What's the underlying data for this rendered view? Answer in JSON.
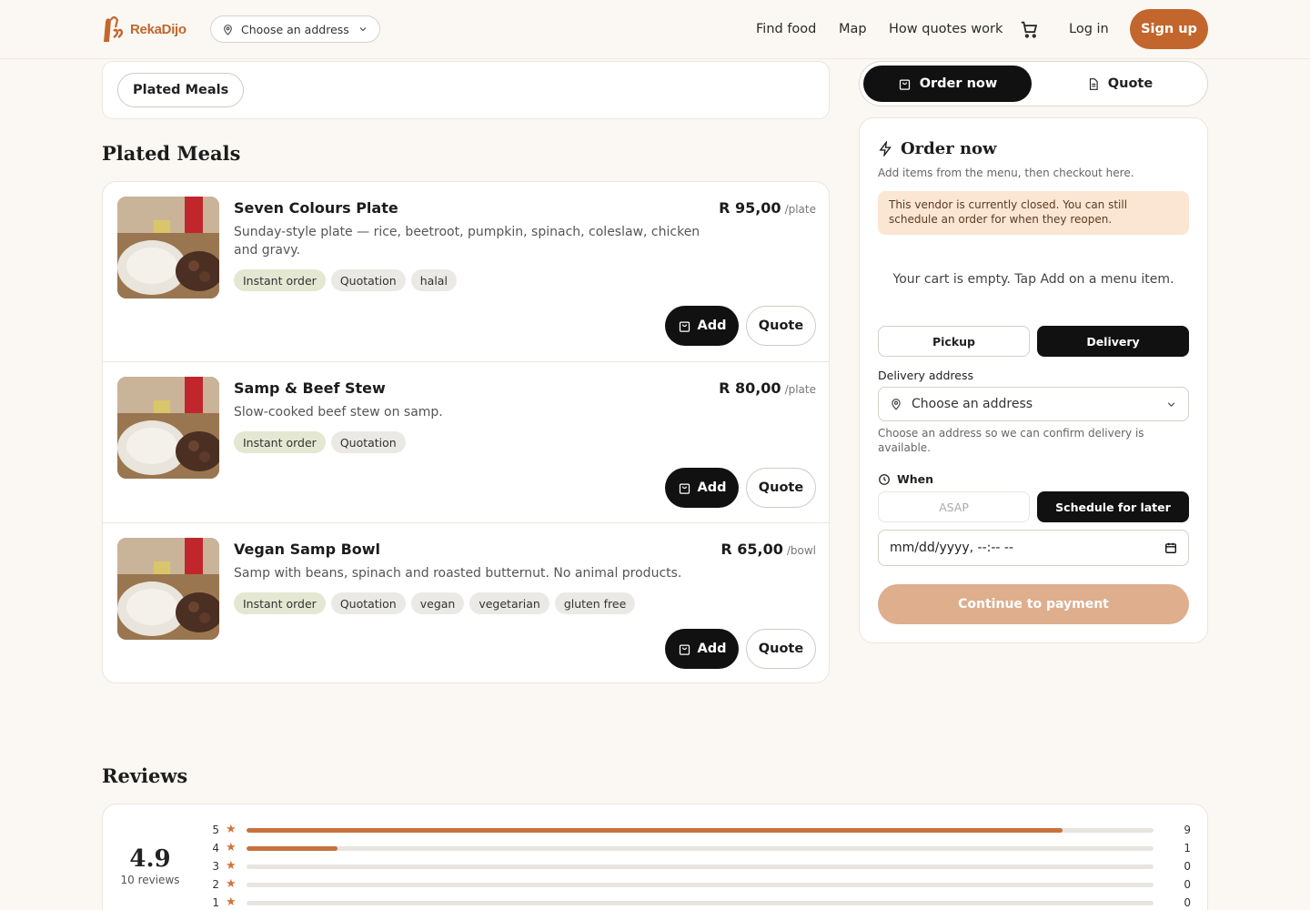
{
  "header": {
    "brand": "RekaDijo",
    "address_pill": "Choose an address",
    "nav": [
      "Find food",
      "Map",
      "How quotes work"
    ],
    "login": "Log in",
    "signup": "Sign up"
  },
  "categories": {
    "active": "Plated Meals"
  },
  "menu": {
    "section_title": "Plated Meals",
    "items": [
      {
        "name": "Seven Colours Plate",
        "description": "Sunday-style plate — rice, beetroot, pumpkin, spinach, coleslaw, chicken and gravy.",
        "price": "R 95,00",
        "unit": "/plate",
        "tags": [
          "Instant order",
          "Quotation",
          "halal"
        ],
        "add_label": "Add",
        "quote_label": "Quote"
      },
      {
        "name": "Samp & Beef Stew",
        "description": "Slow-cooked beef stew on samp.",
        "price": "R 80,00",
        "unit": "/plate",
        "tags": [
          "Instant order",
          "Quotation"
        ],
        "add_label": "Add",
        "quote_label": "Quote"
      },
      {
        "name": "Vegan Samp Bowl",
        "description": "Samp with beans, spinach and roasted butternut. No animal products.",
        "price": "R 65,00",
        "unit": "/bowl",
        "tags": [
          "Instant order",
          "Quotation",
          "vegan",
          "vegetarian",
          "gluten free"
        ],
        "add_label": "Add",
        "quote_label": "Quote"
      }
    ]
  },
  "mode_toggle": {
    "order": "Order now",
    "quote": "Quote"
  },
  "order_panel": {
    "title": "Order now",
    "subtitle": "Add items from the menu, then checkout here.",
    "closed_notice": "This vendor is currently closed. You can still schedule an order for when they reopen.",
    "empty_cart": "Your cart is empty. Tap Add on a menu item.",
    "pickup": "Pickup",
    "delivery": "Delivery",
    "delivery_address_label": "Delivery address",
    "address_placeholder": "Choose an address",
    "address_hint": "Choose an address so we can confirm delivery is available.",
    "when_label": "When",
    "asap": "ASAP",
    "schedule": "Schedule for later",
    "datetime_placeholder": "mm/dd/yyyy, --:-- --",
    "continue": "Continue to payment"
  },
  "reviews": {
    "title": "Reviews",
    "average": "4.9",
    "count_label": "10 reviews",
    "breakdown": [
      {
        "stars": "5",
        "count": "9",
        "fraction": 0.9
      },
      {
        "stars": "4",
        "count": "1",
        "fraction": 0.1
      },
      {
        "stars": "3",
        "count": "0",
        "fraction": 0
      },
      {
        "stars": "2",
        "count": "0",
        "fraction": 0
      },
      {
        "stars": "1",
        "count": "0",
        "fraction": 0
      }
    ]
  },
  "colors": {
    "brand": "#c2662d",
    "background": "#fbf8f3",
    "dark": "#111111",
    "notice": "#fbe6d3",
    "tag_instant": "#e4e8d2"
  },
  "icons": [
    "map-pin-icon",
    "chevron-down-icon",
    "cart-icon",
    "bag-icon",
    "document-icon",
    "bolt-icon",
    "clock-icon",
    "calendar-icon",
    "star-icon"
  ]
}
